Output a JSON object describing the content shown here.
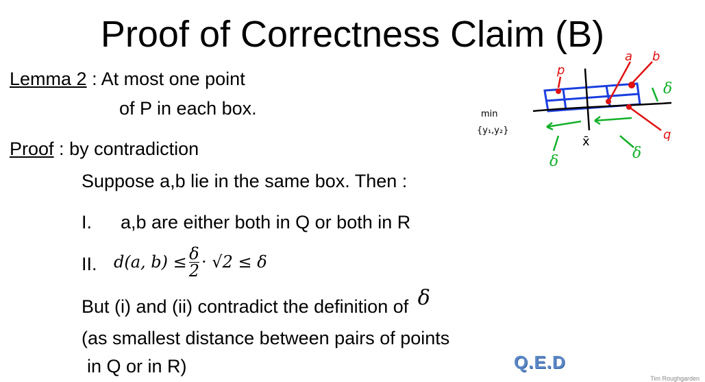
{
  "title": "Proof of Correctness Claim (B)",
  "lemma": {
    "label": "Lemma 2",
    "sep": " : ",
    "line1": "At most one point",
    "line2": "of P in each box."
  },
  "proof": {
    "label": "Proof",
    "sep": " : ",
    "method": "by contradiction",
    "suppose": "Suppose a,b lie in the same box. Then :",
    "item1_num": "I.",
    "item1_text": "a,b are either both in Q or both in R",
    "item2_num": "II.",
    "item2_lhs": "d(a, b) ≤",
    "item2_num_frac": "δ",
    "item2_den_frac": "2",
    "item2_rhs": "· √2 ≤ δ",
    "but_line": "But (i) and (ii) contradict the definition of",
    "delta": "δ",
    "paren_line1": "(as smallest distance between pairs of points",
    "paren_line2": "in Q or in R)"
  },
  "qed": "Q.E.D",
  "sketch": {
    "label_a": "a",
    "label_b": "b",
    "label_p": "p",
    "label_q": "q",
    "label_min": "min",
    "label_y": "{y₁,y₂}",
    "label_xbar": "x̄",
    "label_delta": "δ"
  },
  "footer": "Tim Roughgarden"
}
